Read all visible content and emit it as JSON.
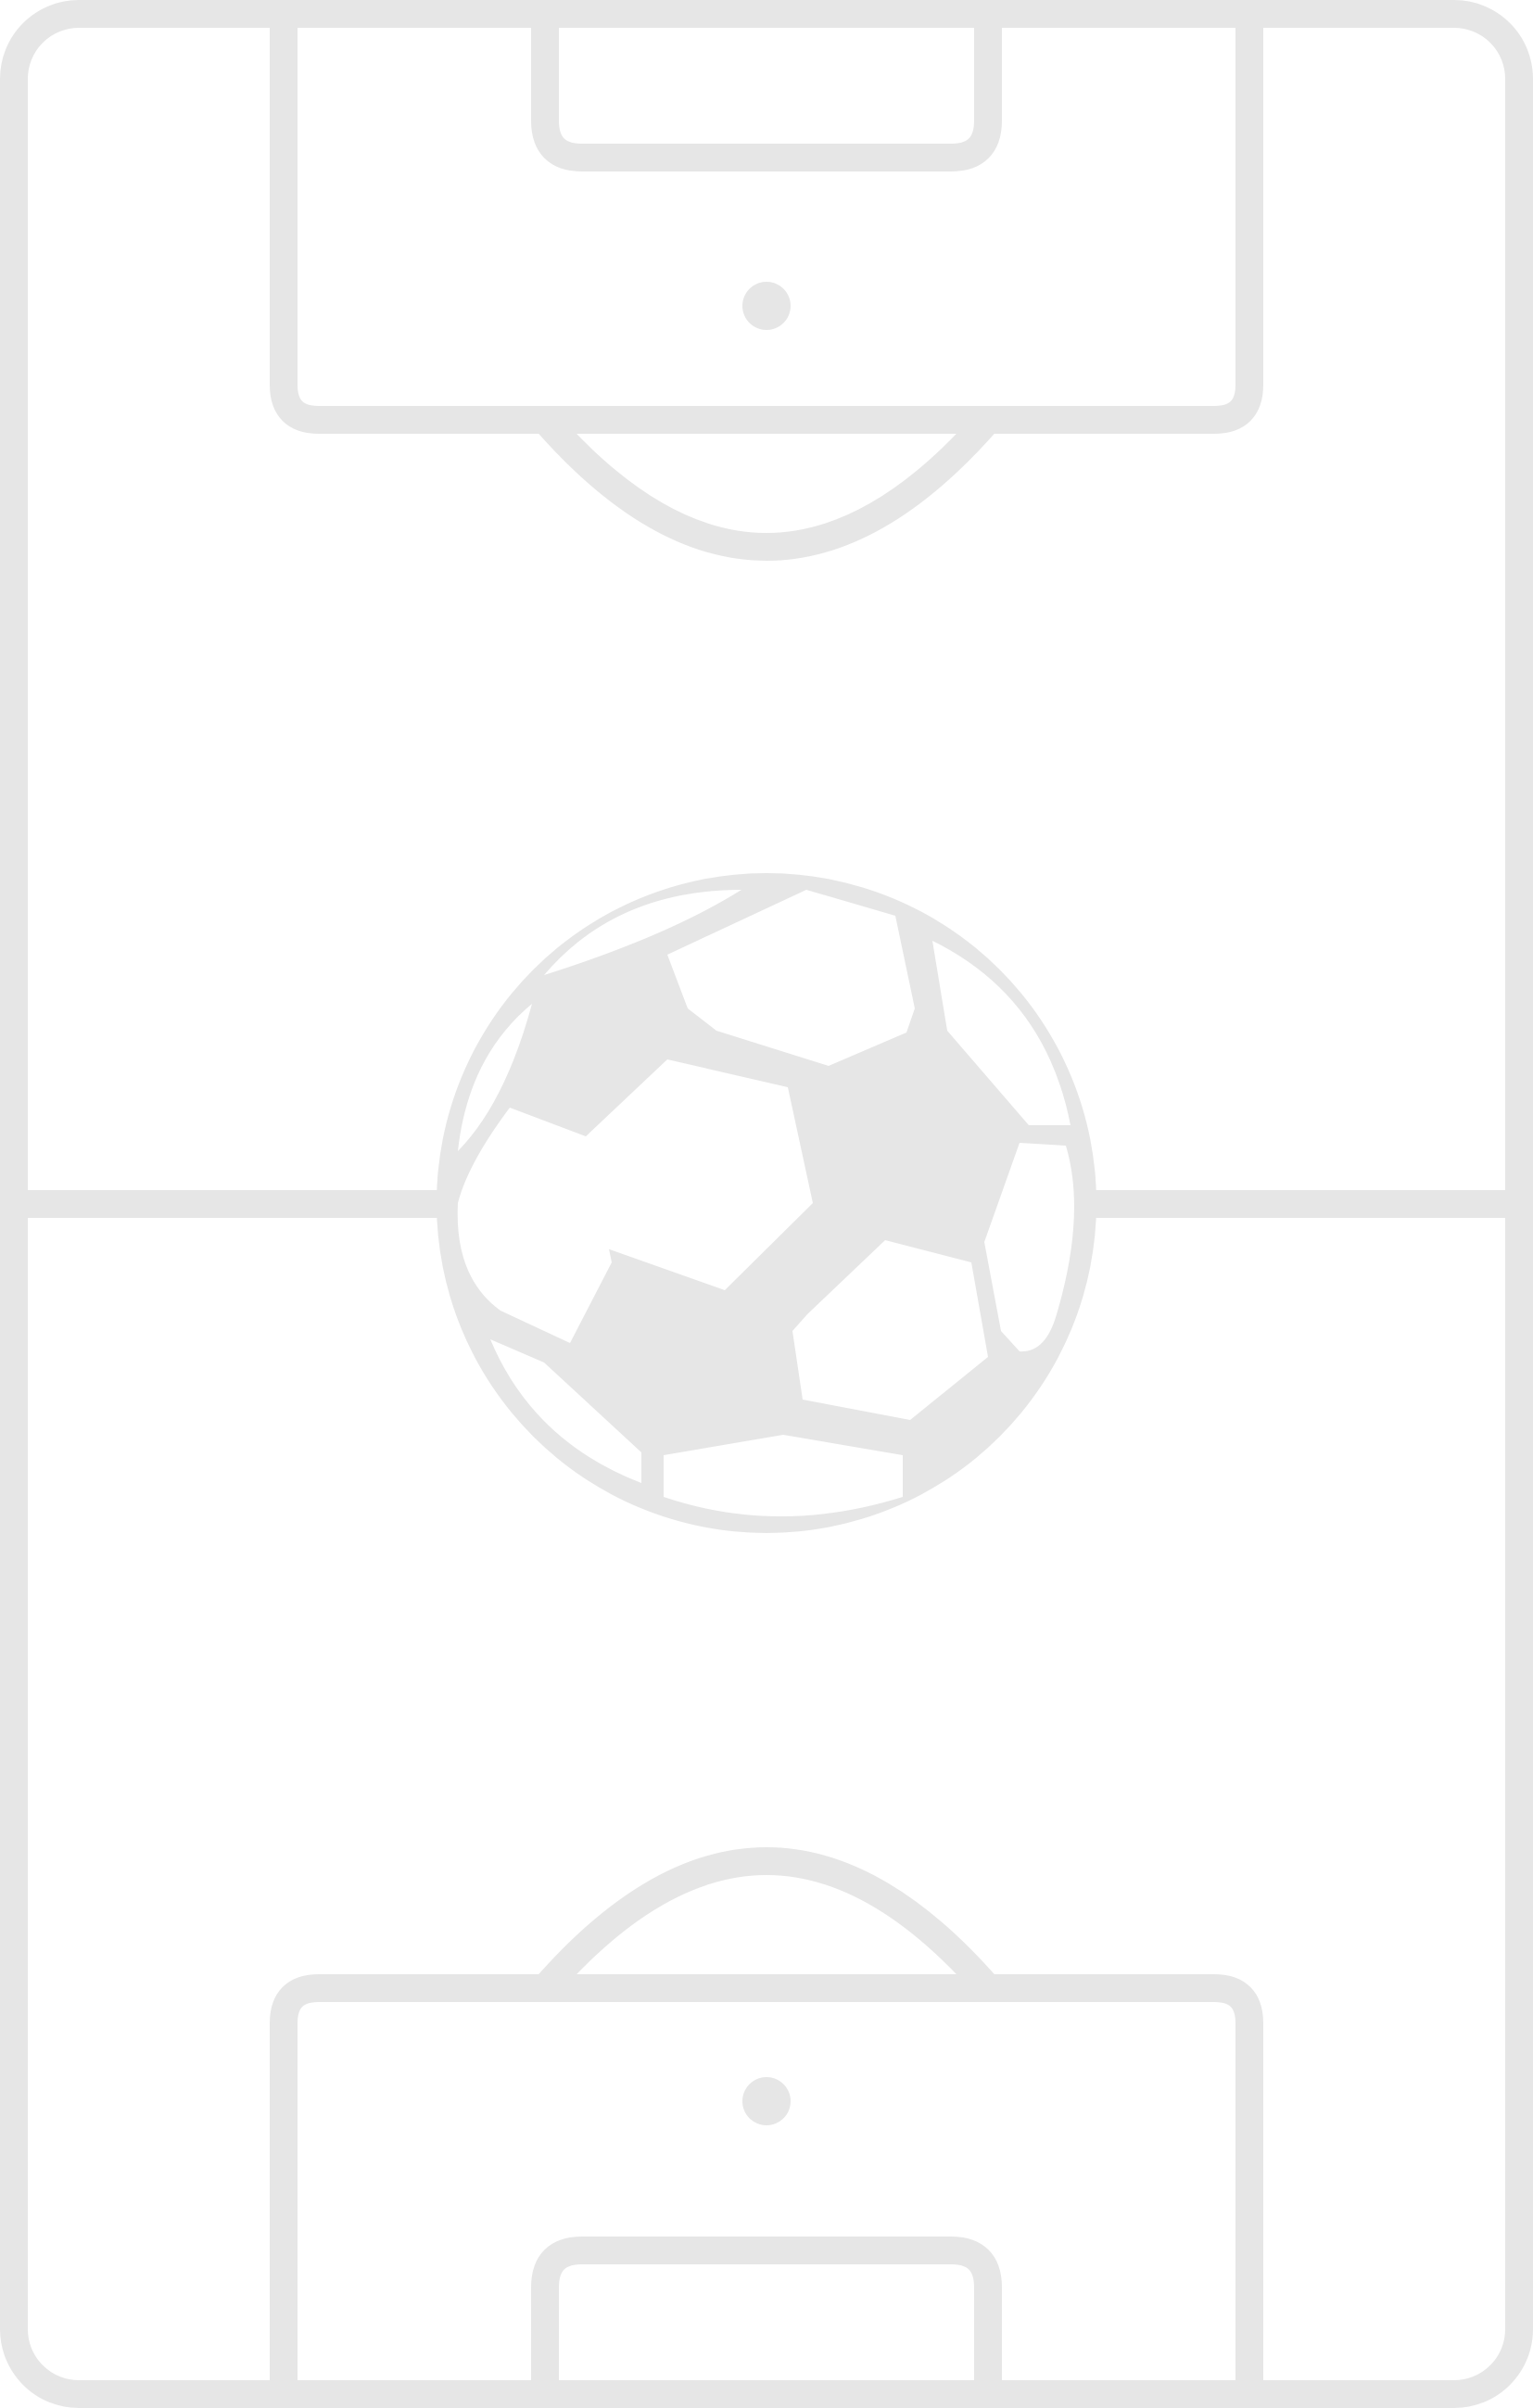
{
  "colors": {
    "line": "#e6e6e6",
    "background": "#ffffff"
  },
  "icons": {
    "field": "soccer-field-icon",
    "ball": "soccer-ball-icon"
  }
}
